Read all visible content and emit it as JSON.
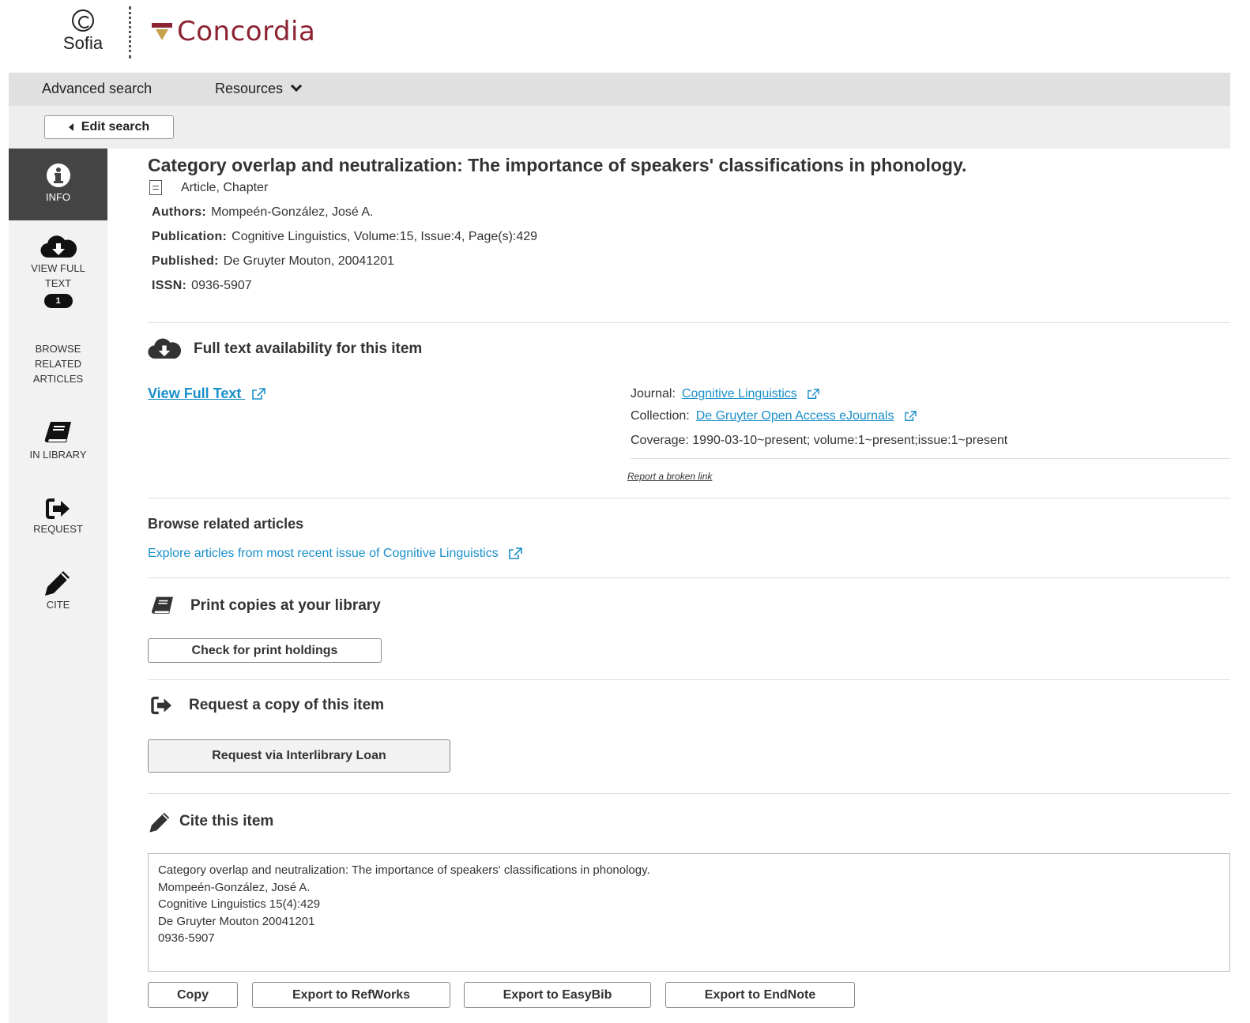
{
  "header": {
    "sofia_label": "Sofia",
    "concordia_label": "Concordia"
  },
  "nav": {
    "advanced_search": "Advanced search",
    "resources": "Resources"
  },
  "edit_search": "Edit search",
  "sidebar": {
    "info": "INFO",
    "view_full_text_1": "VIEW FULL",
    "view_full_text_2": "TEXT",
    "view_full_text_count": "1",
    "browse_1": "BROWSE",
    "browse_2": "RELATED",
    "browse_3": "ARTICLES",
    "in_library": "IN LIBRARY",
    "request": "REQUEST",
    "cite": "CITE"
  },
  "record": {
    "title": "Category overlap and neutralization: The importance of speakers' classifications in phonology.",
    "doc_type": "Article, Chapter",
    "authors_label": "Authors:",
    "authors": "Mompeén-González, José A.",
    "publication_label": "Publication:",
    "publication": "Cognitive Linguistics, Volume:15, Issue:4, Page(s):429",
    "published_label": "Published:",
    "published": "De Gruyter Mouton, 20041201",
    "issn_label": "ISSN:",
    "issn": "0936-5907"
  },
  "fulltext": {
    "heading": "Full text availability for this item",
    "view_full_text": "View Full Text",
    "journal_label": "Journal:",
    "journal": "Cognitive Linguistics",
    "collection_label": "Collection:",
    "collection": "De Gruyter Open Access eJournals",
    "coverage_label": "Coverage:",
    "coverage": "1990-03-10~present; volume:1~present;issue:1~present",
    "report_broken": "Report a broken link"
  },
  "browse": {
    "heading": "Browse related articles",
    "link": "Explore articles from most recent issue of Cognitive Linguistics"
  },
  "print": {
    "heading": "Print copies at your library",
    "button": "Check for print holdings"
  },
  "request": {
    "heading": "Request a copy of this item",
    "button": "Request via Interlibrary Loan"
  },
  "cite": {
    "heading": "Cite this item",
    "lines": [
      "Category overlap and neutralization: The importance of speakers' classifications in phonology.",
      "Mompeén-González, José A.",
      "Cognitive Linguistics 15(4):429",
      "De Gruyter Mouton 20041201",
      "0936-5907"
    ],
    "buttons": {
      "copy": "Copy",
      "refworks": "Export to RefWorks",
      "easybib": "Export to EasyBib",
      "endnote": "Export to EndNote"
    }
  },
  "colors": {
    "brand": "#8c2332",
    "link": "#1a8fc9",
    "sidebar_active": "#444444"
  },
  "icons": [
    "sofia-logo-icon",
    "concordia-crest-icon",
    "chevron-down-icon",
    "back-triangle-icon",
    "info-icon",
    "cloud-download-icon",
    "book-icon",
    "sign-in-arrow-icon",
    "pencil-icon",
    "document-icon",
    "external-link-icon"
  ]
}
